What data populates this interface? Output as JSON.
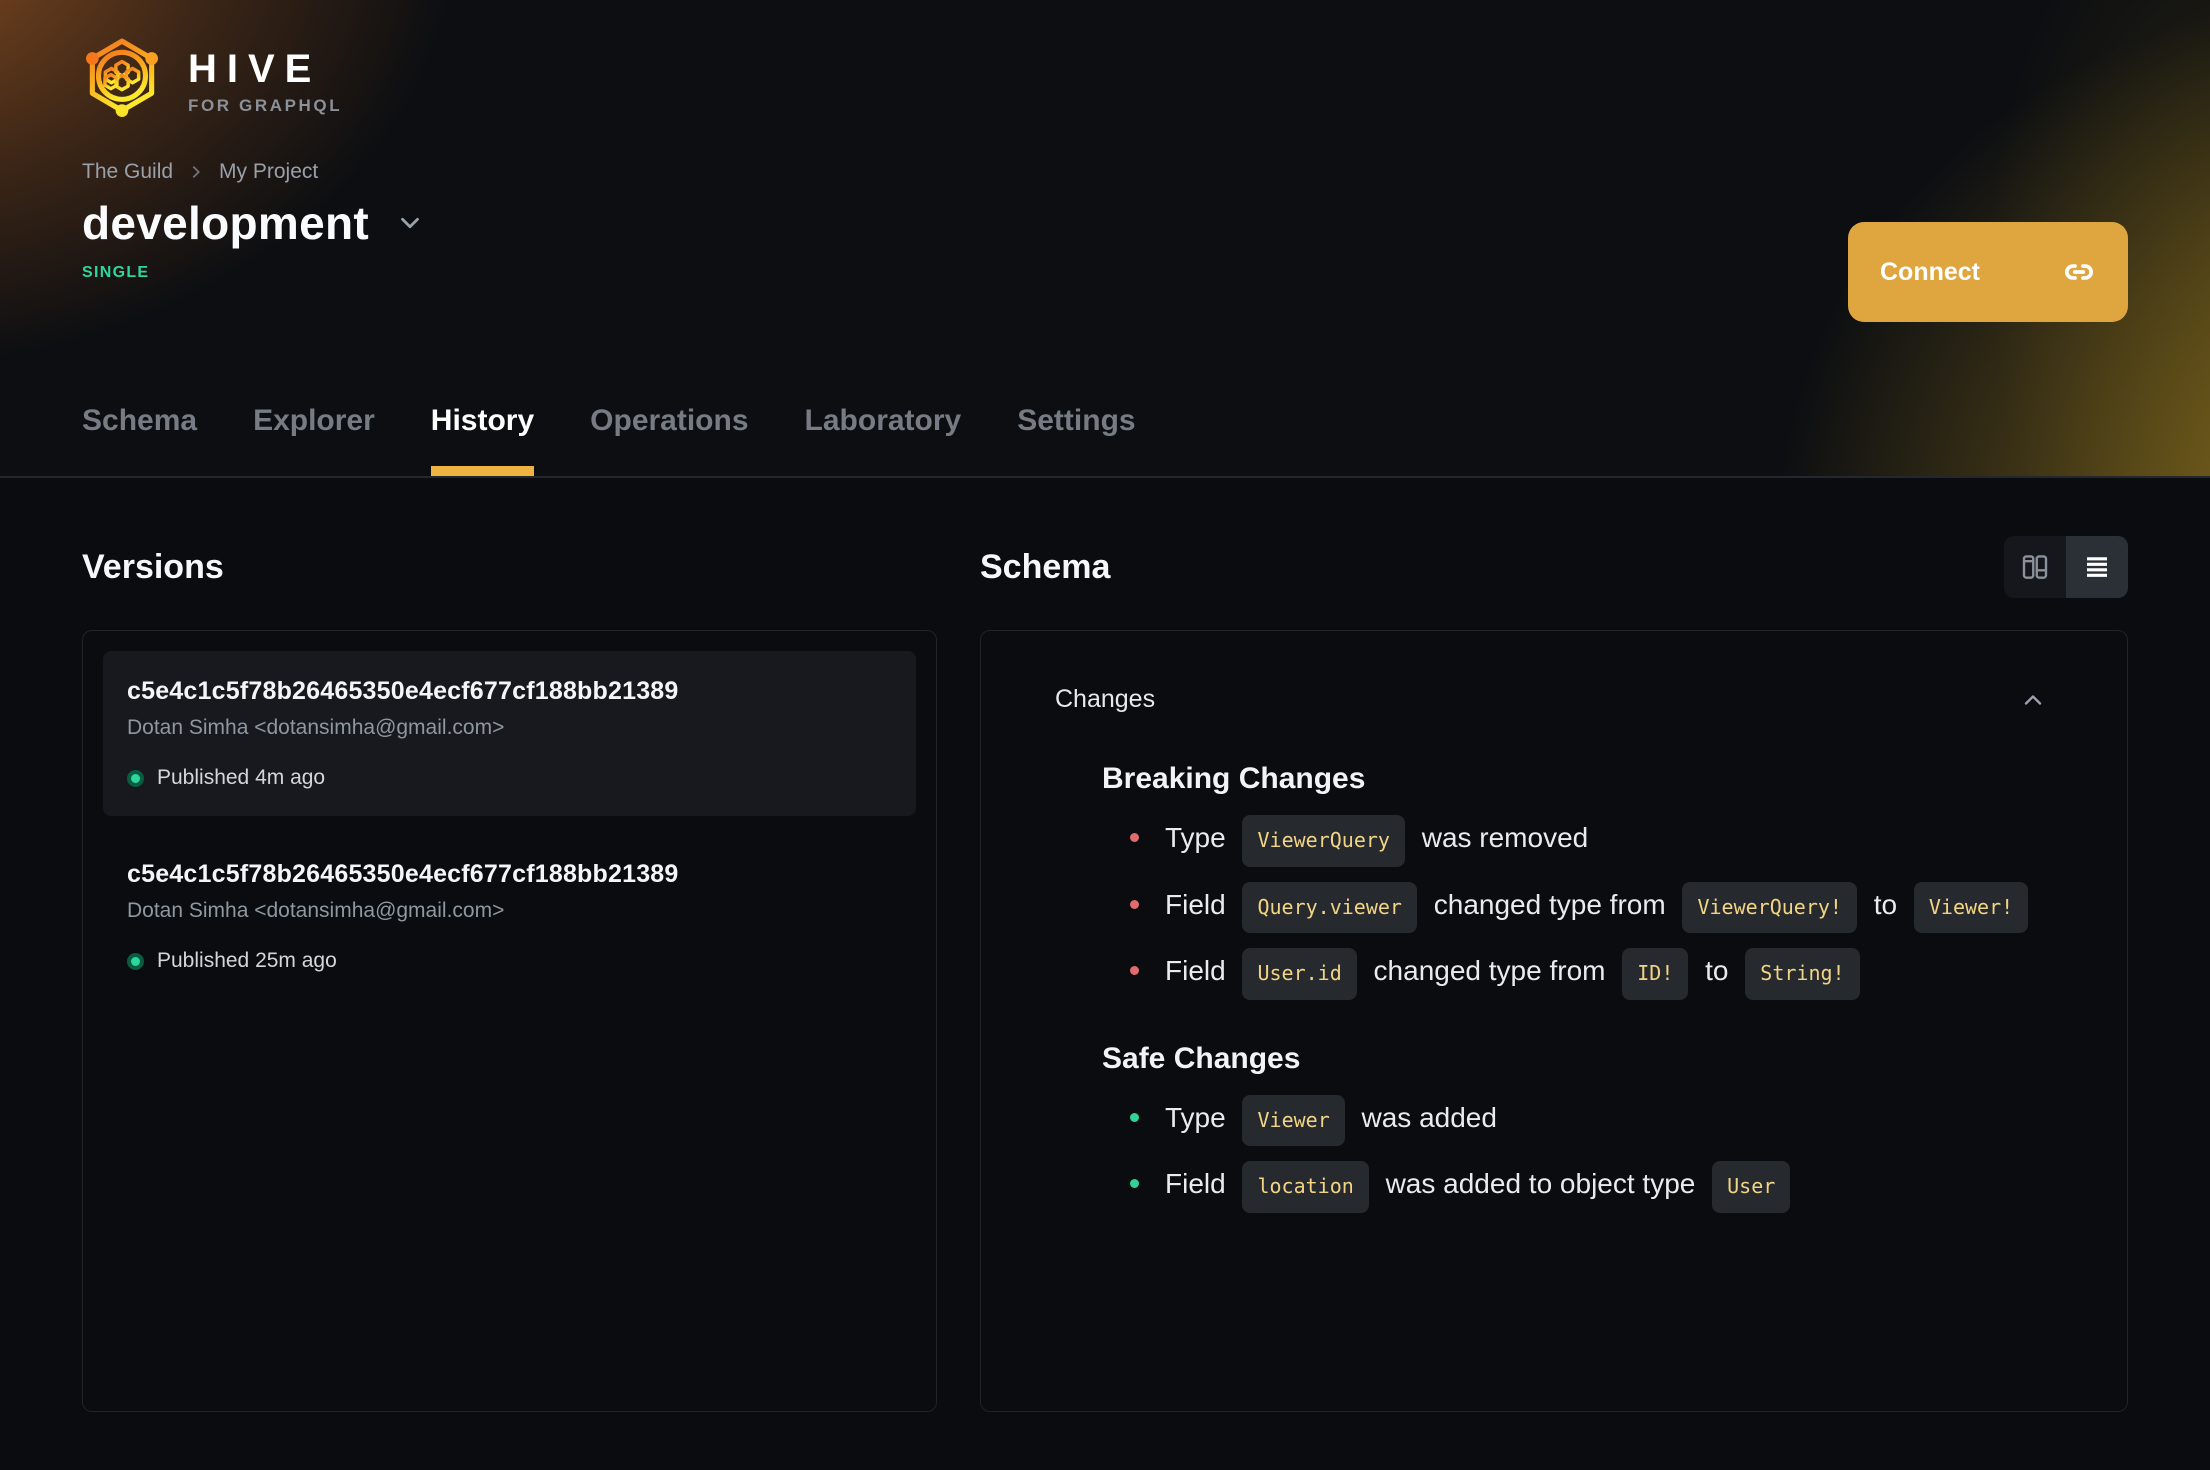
{
  "brand": {
    "name": "HIVE",
    "subtitle": "FOR GRAPHQL"
  },
  "breadcrumb": {
    "org": "The Guild",
    "project": "My Project"
  },
  "target": {
    "name": "development",
    "badge": "SINGLE"
  },
  "connect": {
    "label": "Connect",
    "icon": "link-icon"
  },
  "tabs": [
    {
      "label": "Schema",
      "active": false
    },
    {
      "label": "Explorer",
      "active": false
    },
    {
      "label": "History",
      "active": true
    },
    {
      "label": "Operations",
      "active": false
    },
    {
      "label": "Laboratory",
      "active": false
    },
    {
      "label": "Settings",
      "active": false
    }
  ],
  "versions": {
    "title": "Versions",
    "items": [
      {
        "hash": "c5e4c1c5f78b26465350e4ecf677cf188bb21389",
        "author": "Dotan Simha <dotansimha@gmail.com>",
        "status": "Published 4m ago",
        "selected": true
      },
      {
        "hash": "c5e4c1c5f78b26465350e4ecf677cf188bb21389",
        "author": "Dotan Simha <dotansimha@gmail.com>",
        "status": "Published 25m ago",
        "selected": false
      }
    ]
  },
  "schema": {
    "title": "Schema",
    "panel_title": "Changes",
    "view_toggle": {
      "left_icon": "columns-view-icon",
      "right_icon": "list-view-icon",
      "selected": "list"
    },
    "sections": [
      {
        "title": "Breaking Changes",
        "severity": "breaking",
        "items": [
          {
            "parts": [
              {
                "t": "text",
                "v": "Type"
              },
              {
                "t": "code",
                "v": "ViewerQuery"
              },
              {
                "t": "text",
                "v": "was removed"
              }
            ]
          },
          {
            "parts": [
              {
                "t": "text",
                "v": "Field"
              },
              {
                "t": "code",
                "v": "Query.viewer"
              },
              {
                "t": "text",
                "v": "changed type from"
              },
              {
                "t": "code",
                "v": "ViewerQuery!"
              },
              {
                "t": "text",
                "v": "to"
              },
              {
                "t": "code",
                "v": "Viewer!"
              }
            ]
          },
          {
            "parts": [
              {
                "t": "text",
                "v": "Field"
              },
              {
                "t": "code",
                "v": "User.id"
              },
              {
                "t": "text",
                "v": "changed type from"
              },
              {
                "t": "code",
                "v": "ID!"
              },
              {
                "t": "text",
                "v": "to"
              },
              {
                "t": "code",
                "v": "String!"
              }
            ]
          }
        ]
      },
      {
        "title": "Safe Changes",
        "severity": "safe",
        "items": [
          {
            "parts": [
              {
                "t": "text",
                "v": "Type"
              },
              {
                "t": "code",
                "v": "Viewer"
              },
              {
                "t": "text",
                "v": "was added"
              }
            ]
          },
          {
            "parts": [
              {
                "t": "text",
                "v": "Field"
              },
              {
                "t": "code",
                "v": "location"
              },
              {
                "t": "text",
                "v": "was added to object type"
              },
              {
                "t": "code",
                "v": "User"
              }
            ]
          }
        ]
      }
    ]
  },
  "colors": {
    "accent_amber": "#efb341",
    "connect_button": "#dfa63f",
    "badge_green": "#2fd6a0",
    "published_dot": "#2bd79b",
    "breaking_bullet": "#e06b70",
    "safe_bullet": "#2fd395",
    "chip_text": "#f2d584",
    "chip_bg": "#26292e",
    "header_bg": "#0c0e11",
    "page_bg": "#0a0c0f"
  }
}
